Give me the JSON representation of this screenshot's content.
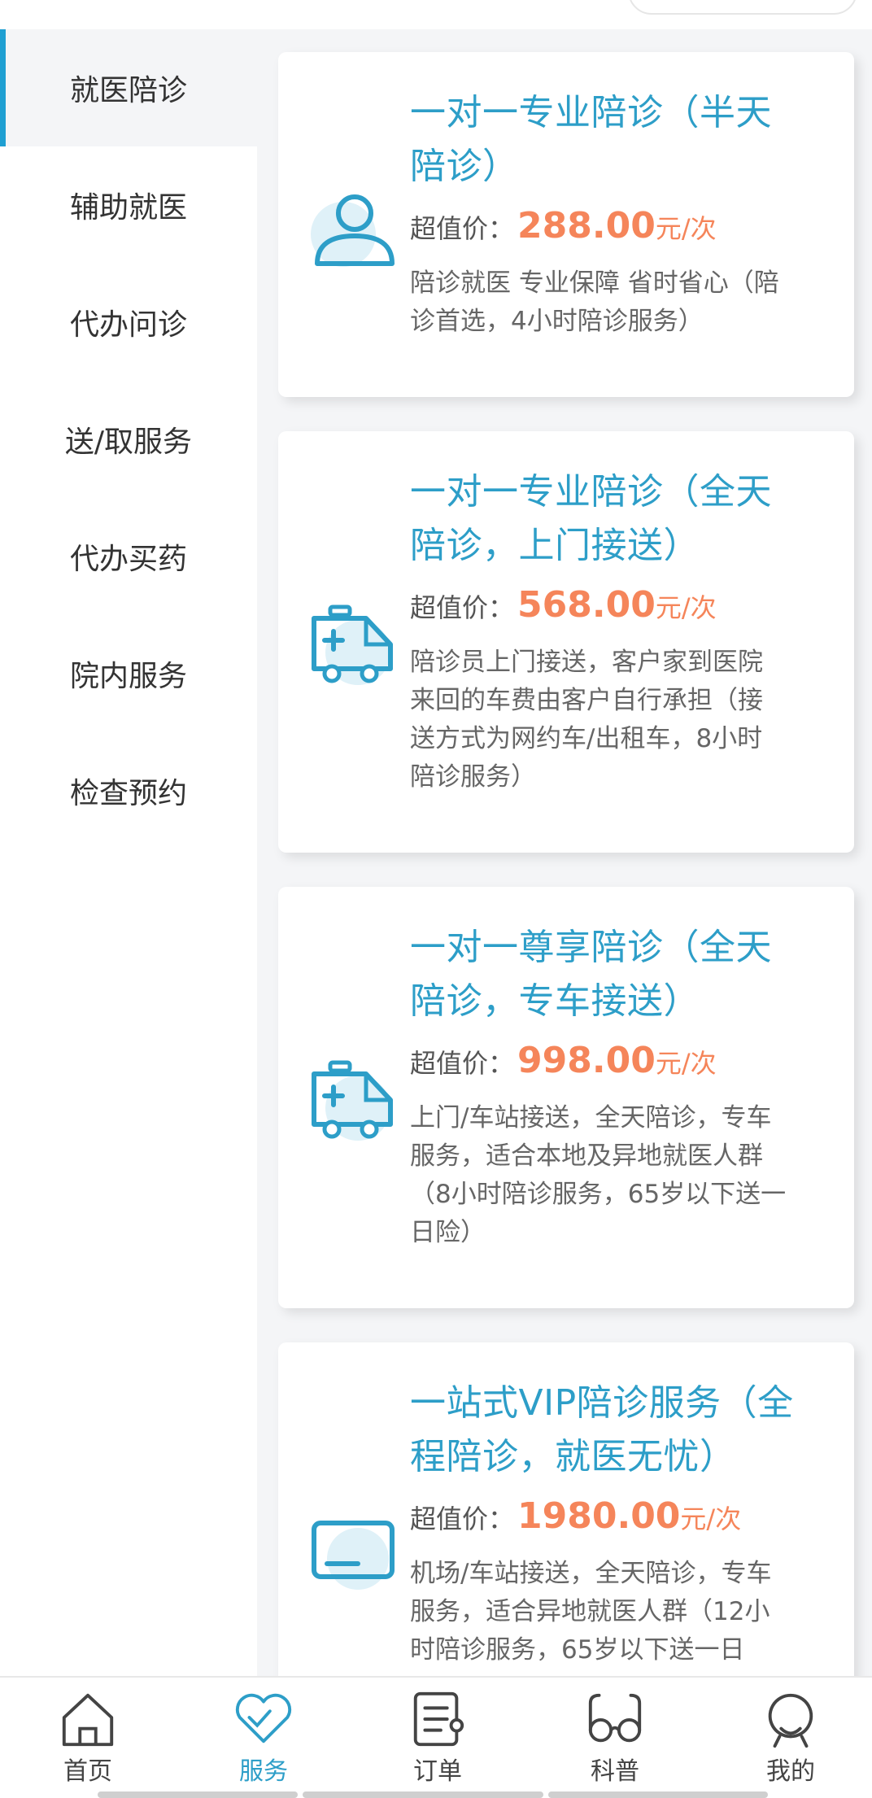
{
  "sidebar": {
    "items": [
      {
        "label": "就医陪诊",
        "active": true
      },
      {
        "label": "辅助就医",
        "active": false
      },
      {
        "label": "代办问诊",
        "active": false
      },
      {
        "label": "送/取服务",
        "active": false
      },
      {
        "label": "代办买药",
        "active": false
      },
      {
        "label": "院内服务",
        "active": false
      },
      {
        "label": "检查预约",
        "active": false
      }
    ]
  },
  "cards": [
    {
      "icon": "person-icon",
      "title_line1": "一对一专业陪诊（半天",
      "title_line2": "陪诊）",
      "price_label": "超值价：",
      "price_value": "288.00",
      "price_unit": "元/次",
      "desc_lines": [
        "陪诊就医 专业保障 省时省心（陪",
        "诊首选，4小时陪诊服务）"
      ]
    },
    {
      "icon": "ambulance-icon",
      "title_line1": "一对一专业陪诊（全天",
      "title_line2": "陪诊，上门接送）",
      "price_label": "超值价：",
      "price_value": "568.00",
      "price_unit": "元/次",
      "desc_lines": [
        "陪诊员上门接送，客户家到医院",
        "来回的车费由客户自行承担（接",
        "送方式为网约车/出租车，8小时",
        "陪诊服务）"
      ]
    },
    {
      "icon": "ambulance-icon",
      "title_line1": "一对一尊享陪诊（全天",
      "title_line2": "陪诊，专车接送）",
      "price_label": "超值价：",
      "price_value": "998.00",
      "price_unit": "元/次",
      "desc_lines": [
        "上门/车站接送，全天陪诊，专车",
        "服务，适合本地及异地就医人群",
        "（8小时陪诊服务，65岁以下送一",
        "日险）"
      ]
    },
    {
      "icon": "card-icon",
      "title_line1": "一站式VIP陪诊服务（全",
      "title_line2": "程陪诊，就医无忧）",
      "price_label": "超值价：",
      "price_value": "1980.00",
      "price_unit": "元/次",
      "desc_lines": [
        "机场/车站接送，全天陪诊，专车",
        "服务，适合异地就医人群（12小",
        "时陪诊服务，65岁以下送一日"
      ]
    }
  ],
  "tabbar": {
    "tabs": [
      {
        "label": "首页",
        "icon": "home-icon",
        "active": false
      },
      {
        "label": "服务",
        "icon": "heart-icon",
        "active": true
      },
      {
        "label": "订单",
        "icon": "order-icon",
        "active": false
      },
      {
        "label": "科普",
        "icon": "glasses-icon",
        "active": false
      },
      {
        "label": "我的",
        "icon": "profile-icon",
        "active": false
      }
    ]
  },
  "colors": {
    "accent": "#2d9ec8",
    "price": "#f5855a",
    "icon_bg": "#dff1f8"
  }
}
